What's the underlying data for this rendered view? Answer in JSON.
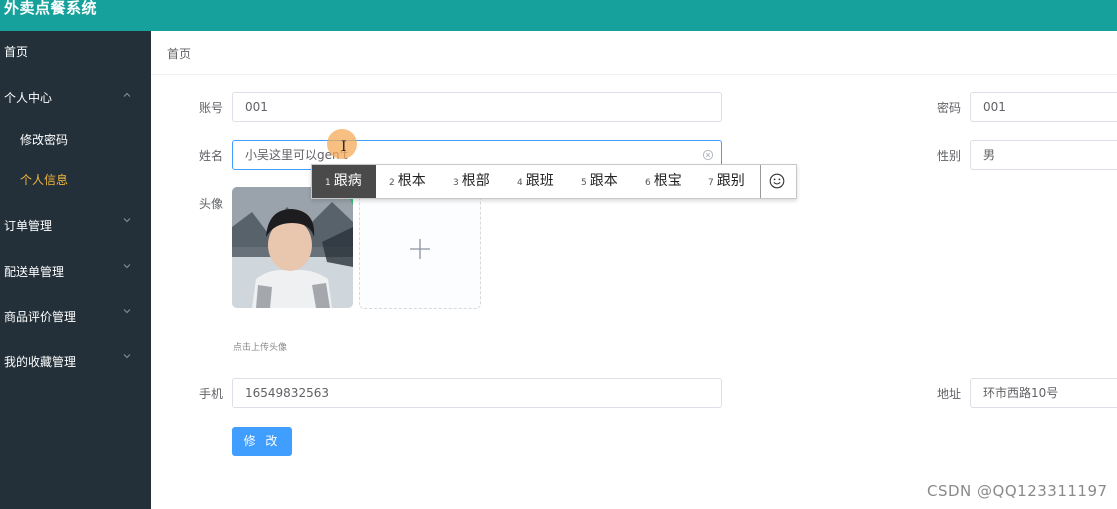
{
  "app": {
    "title": "外卖点餐系统"
  },
  "sidebar": {
    "items": [
      {
        "label": "首页"
      },
      {
        "label": "个人中心"
      },
      {
        "label": "订单管理"
      },
      {
        "label": "配送单管理"
      },
      {
        "label": "商品评价管理"
      },
      {
        "label": "我的收藏管理"
      }
    ],
    "subitems": [
      {
        "label": "修改密码"
      },
      {
        "label": "个人信息",
        "active": true
      }
    ]
  },
  "breadcrumb": "首页",
  "form": {
    "account_label": "账号",
    "account_value": "001",
    "password_label": "密码",
    "password_value": "001",
    "name_label": "姓名",
    "name_value": "小吴这里可以gen't",
    "gender_label": "性别",
    "gender_value": "男",
    "avatar_label": "头像",
    "upload_hint": "点击上传头像",
    "phone_label": "手机",
    "phone_value": "16549832563",
    "address_label": "地址",
    "address_value": "环市西路10号",
    "submit_label": "修 改"
  },
  "ime": {
    "candidates": [
      {
        "num": "1",
        "text": "跟病",
        "selected": true
      },
      {
        "num": "2",
        "text": "根本"
      },
      {
        "num": "3",
        "text": "根部"
      },
      {
        "num": "4",
        "text": "跟班"
      },
      {
        "num": "5",
        "text": "跟本"
      },
      {
        "num": "6",
        "text": "根宝"
      },
      {
        "num": "7",
        "text": "跟别"
      }
    ],
    "emoji_icon": "smiley-icon"
  },
  "watermark": "CSDN @QQ123311197",
  "colors": {
    "topbar": "#17a19c",
    "sidebar": "#23303a",
    "active_menu": "#f3b53b",
    "primary": "#409eff"
  }
}
